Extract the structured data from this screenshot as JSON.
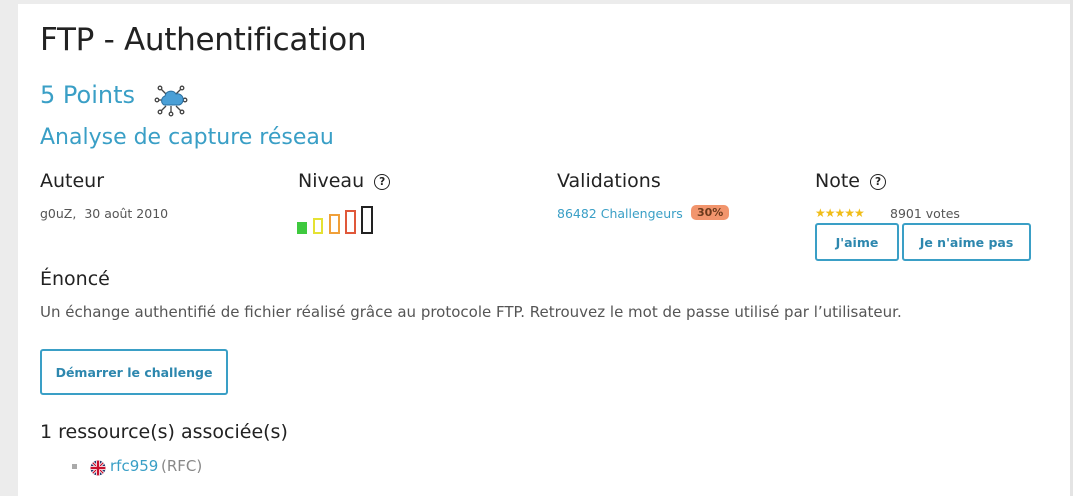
{
  "challenge": {
    "title": "FTP - Authentification",
    "points": "5 Points",
    "category": "Analyse de capture réseau"
  },
  "columns": {
    "author_label": "Auteur",
    "level_label": "Niveau",
    "validations_label": "Validations",
    "note_label": "Note",
    "help_glyph": "?"
  },
  "author": {
    "name": "g0uZ,",
    "date": "30 août 2010"
  },
  "level": {
    "value": 1,
    "max": 5,
    "colors": [
      "#3ec93e",
      "#e5e233",
      "#f0a03a",
      "#e0583a",
      "#222222"
    ]
  },
  "validations": {
    "link": "86482 Challengeurs",
    "percent": "30%"
  },
  "rating": {
    "stars": "★★★★★",
    "votes": "8901 votes",
    "like_label": "J'aime",
    "dislike_label": "Je n'aime pas"
  },
  "statement": {
    "heading": "Énoncé",
    "text": "Un échange authentifié de fichier réalisé grâce au protocole FTP. Retrouvez le mot de passe utilisé par l’utilisateur."
  },
  "start_label": "Démarrer le challenge",
  "resources": {
    "heading": "1 ressource(s) associée(s)",
    "items": [
      {
        "link": "rfc959",
        "type": "(RFC)",
        "icon": "uk-flag-icon"
      }
    ]
  },
  "colors": {
    "accent": "#3a9fc6",
    "badge": "#f2956d"
  }
}
